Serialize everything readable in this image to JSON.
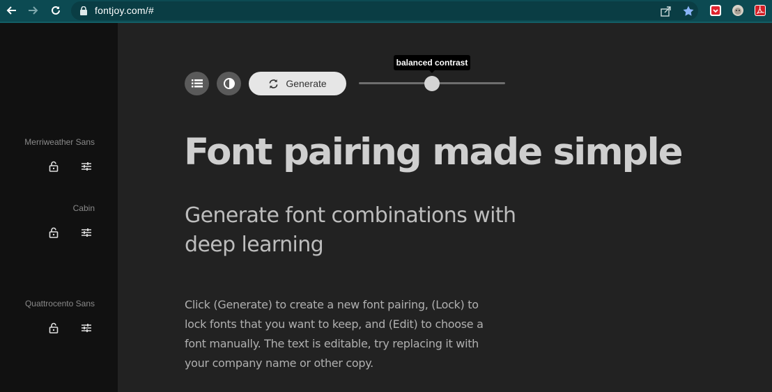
{
  "browser": {
    "url": "fontjoy.com/#",
    "icons": [
      "back-arrow-icon",
      "forward-arrow-icon",
      "reload-icon",
      "lock-icon",
      "share-icon",
      "bookmark-star-icon"
    ],
    "extensions": [
      "pocket-extension-icon",
      "profile-extension-icon",
      "pdf-extension-icon"
    ]
  },
  "sidebar": {
    "fonts": [
      {
        "name": "Merriweather Sans"
      },
      {
        "name": "Cabin"
      },
      {
        "name": "Quattrocento Sans"
      }
    ]
  },
  "toolbar": {
    "generate_label": "Generate",
    "contrast_tooltip": "balanced contrast",
    "contrast_level": 0.5
  },
  "content": {
    "headline": "Font pairing made simple",
    "subhead": "Generate font combinations with deep learning",
    "body": "Click (Generate) to create a new font pairing, (Lock) to lock fonts that you want to keep, and (Edit) to choose a font manually. The text is editable, try replacing it with your company name or other copy."
  },
  "colors": {
    "chrome": "#0c4a52",
    "page_bg": "#222222",
    "sidebar_bg": "#111111",
    "headline": "#cfcfcf"
  }
}
